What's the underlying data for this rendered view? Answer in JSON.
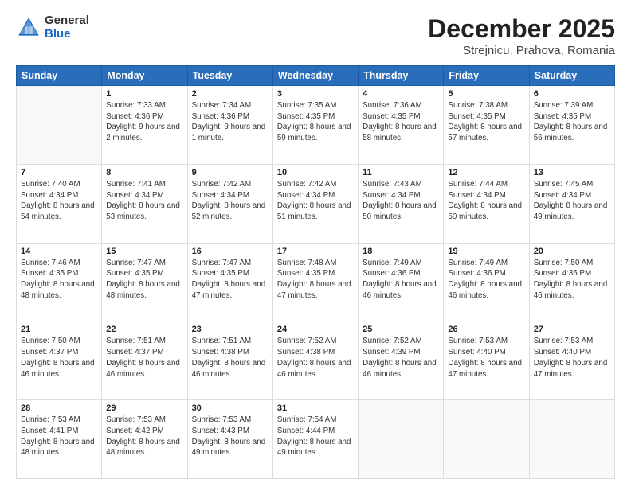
{
  "header": {
    "logo": {
      "general": "General",
      "blue": "Blue"
    },
    "title": "December 2025",
    "subtitle": "Strejnicu, Prahova, Romania"
  },
  "weekdays": [
    "Sunday",
    "Monday",
    "Tuesday",
    "Wednesday",
    "Thursday",
    "Friday",
    "Saturday"
  ],
  "weeks": [
    [
      {
        "day": "",
        "empty": true
      },
      {
        "day": "1",
        "sunrise": "7:33 AM",
        "sunset": "4:36 PM",
        "daylight": "9 hours and 2 minutes."
      },
      {
        "day": "2",
        "sunrise": "7:34 AM",
        "sunset": "4:36 PM",
        "daylight": "9 hours and 1 minute."
      },
      {
        "day": "3",
        "sunrise": "7:35 AM",
        "sunset": "4:35 PM",
        "daylight": "8 hours and 59 minutes."
      },
      {
        "day": "4",
        "sunrise": "7:36 AM",
        "sunset": "4:35 PM",
        "daylight": "8 hours and 58 minutes."
      },
      {
        "day": "5",
        "sunrise": "7:38 AM",
        "sunset": "4:35 PM",
        "daylight": "8 hours and 57 minutes."
      },
      {
        "day": "6",
        "sunrise": "7:39 AM",
        "sunset": "4:35 PM",
        "daylight": "8 hours and 56 minutes."
      }
    ],
    [
      {
        "day": "7",
        "sunrise": "7:40 AM",
        "sunset": "4:34 PM",
        "daylight": "8 hours and 54 minutes."
      },
      {
        "day": "8",
        "sunrise": "7:41 AM",
        "sunset": "4:34 PM",
        "daylight": "8 hours and 53 minutes."
      },
      {
        "day": "9",
        "sunrise": "7:42 AM",
        "sunset": "4:34 PM",
        "daylight": "8 hours and 52 minutes."
      },
      {
        "day": "10",
        "sunrise": "7:42 AM",
        "sunset": "4:34 PM",
        "daylight": "8 hours and 51 minutes."
      },
      {
        "day": "11",
        "sunrise": "7:43 AM",
        "sunset": "4:34 PM",
        "daylight": "8 hours and 50 minutes."
      },
      {
        "day": "12",
        "sunrise": "7:44 AM",
        "sunset": "4:34 PM",
        "daylight": "8 hours and 50 minutes."
      },
      {
        "day": "13",
        "sunrise": "7:45 AM",
        "sunset": "4:34 PM",
        "daylight": "8 hours and 49 minutes."
      }
    ],
    [
      {
        "day": "14",
        "sunrise": "7:46 AM",
        "sunset": "4:35 PM",
        "daylight": "8 hours and 48 minutes."
      },
      {
        "day": "15",
        "sunrise": "7:47 AM",
        "sunset": "4:35 PM",
        "daylight": "8 hours and 48 minutes."
      },
      {
        "day": "16",
        "sunrise": "7:47 AM",
        "sunset": "4:35 PM",
        "daylight": "8 hours and 47 minutes."
      },
      {
        "day": "17",
        "sunrise": "7:48 AM",
        "sunset": "4:35 PM",
        "daylight": "8 hours and 47 minutes."
      },
      {
        "day": "18",
        "sunrise": "7:49 AM",
        "sunset": "4:36 PM",
        "daylight": "8 hours and 46 minutes."
      },
      {
        "day": "19",
        "sunrise": "7:49 AM",
        "sunset": "4:36 PM",
        "daylight": "8 hours and 46 minutes."
      },
      {
        "day": "20",
        "sunrise": "7:50 AM",
        "sunset": "4:36 PM",
        "daylight": "8 hours and 46 minutes."
      }
    ],
    [
      {
        "day": "21",
        "sunrise": "7:50 AM",
        "sunset": "4:37 PM",
        "daylight": "8 hours and 46 minutes."
      },
      {
        "day": "22",
        "sunrise": "7:51 AM",
        "sunset": "4:37 PM",
        "daylight": "8 hours and 46 minutes."
      },
      {
        "day": "23",
        "sunrise": "7:51 AM",
        "sunset": "4:38 PM",
        "daylight": "8 hours and 46 minutes."
      },
      {
        "day": "24",
        "sunrise": "7:52 AM",
        "sunset": "4:38 PM",
        "daylight": "8 hours and 46 minutes."
      },
      {
        "day": "25",
        "sunrise": "7:52 AM",
        "sunset": "4:39 PM",
        "daylight": "8 hours and 46 minutes."
      },
      {
        "day": "26",
        "sunrise": "7:53 AM",
        "sunset": "4:40 PM",
        "daylight": "8 hours and 47 minutes."
      },
      {
        "day": "27",
        "sunrise": "7:53 AM",
        "sunset": "4:40 PM",
        "daylight": "8 hours and 47 minutes."
      }
    ],
    [
      {
        "day": "28",
        "sunrise": "7:53 AM",
        "sunset": "4:41 PM",
        "daylight": "8 hours and 48 minutes."
      },
      {
        "day": "29",
        "sunrise": "7:53 AM",
        "sunset": "4:42 PM",
        "daylight": "8 hours and 48 minutes."
      },
      {
        "day": "30",
        "sunrise": "7:53 AM",
        "sunset": "4:43 PM",
        "daylight": "8 hours and 49 minutes."
      },
      {
        "day": "31",
        "sunrise": "7:54 AM",
        "sunset": "4:44 PM",
        "daylight": "8 hours and 49 minutes."
      },
      {
        "day": "",
        "empty": true
      },
      {
        "day": "",
        "empty": true
      },
      {
        "day": "",
        "empty": true
      }
    ]
  ]
}
